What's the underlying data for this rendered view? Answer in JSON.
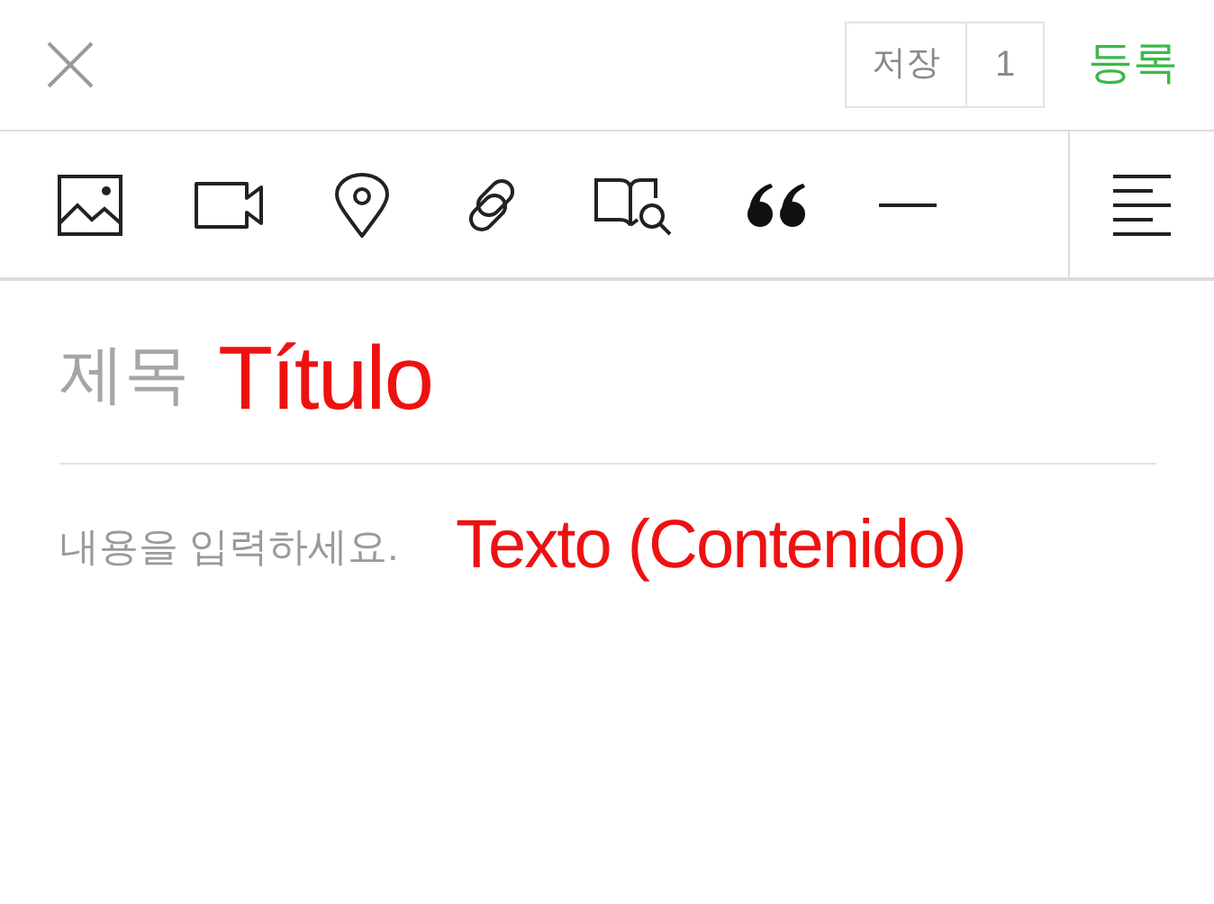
{
  "header": {
    "save_label": "저장",
    "save_count": "1",
    "publish": "등록"
  },
  "toolbar": {
    "tools": [
      {
        "kind": "image"
      },
      {
        "kind": "video"
      },
      {
        "kind": "place"
      },
      {
        "kind": "link"
      },
      {
        "kind": "book"
      },
      {
        "kind": "quote"
      },
      {
        "kind": "divider"
      }
    ],
    "align": {
      "kind": "left"
    }
  },
  "title": {
    "placeholder": "제목",
    "annotation": "Título"
  },
  "body": {
    "placeholder": "내용을 입력하세요.",
    "annotation": "Texto (Contenido)"
  }
}
